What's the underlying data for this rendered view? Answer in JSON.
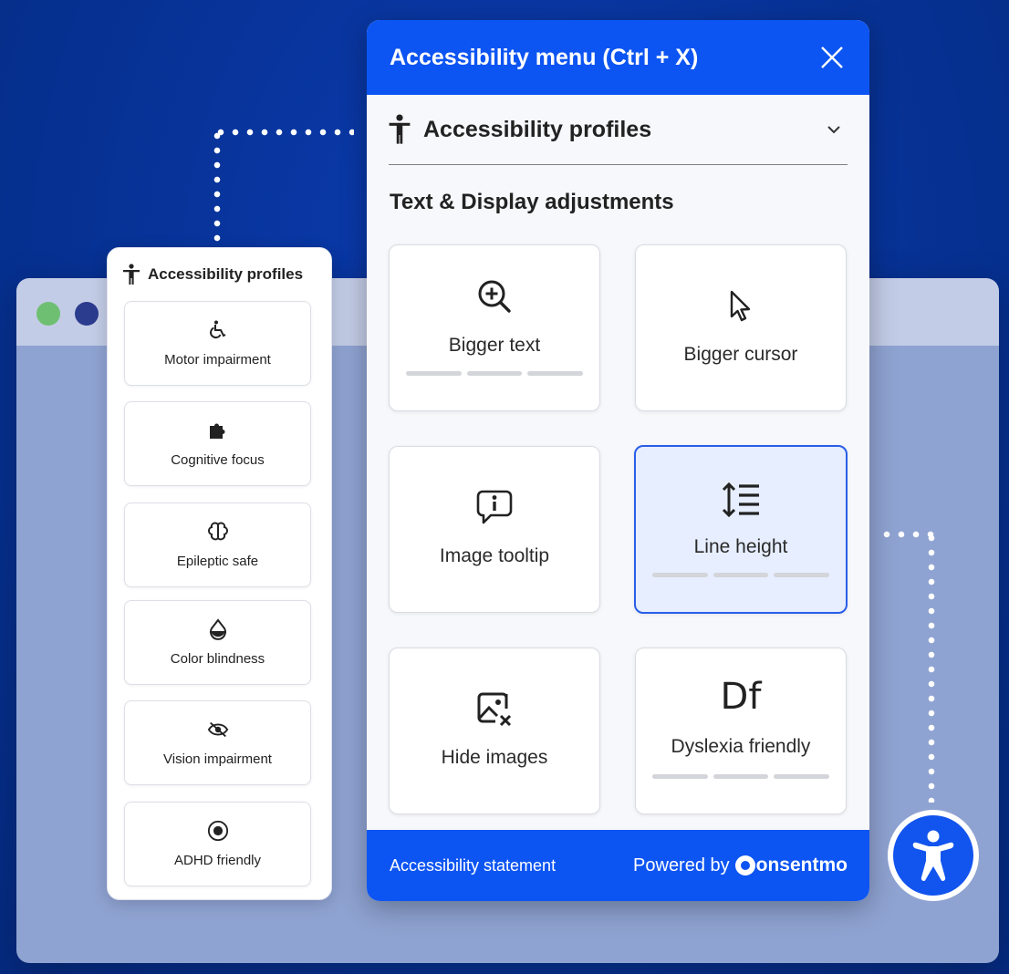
{
  "colors": {
    "background": "#0a36a0",
    "accent": "#0d55f2",
    "active_tile_bg": "#e6eeff",
    "active_tile_border": "#2a5ee8"
  },
  "menu": {
    "title": "Accessibility menu (Ctrl + X)",
    "profiles_label": "Accessibility profiles",
    "section_title": "Text & Display adjustments",
    "tiles": [
      {
        "label": "Bigger text",
        "icon": "zoom-in-icon",
        "levels": 3
      },
      {
        "label": "Bigger cursor",
        "icon": "cursor-icon"
      },
      {
        "label": "Image tooltip",
        "icon": "info-bubble-icon"
      },
      {
        "label": "Line height",
        "icon": "line-height-icon",
        "levels": 3,
        "active": true
      },
      {
        "label": "Hide images",
        "icon": "hide-image-icon"
      },
      {
        "label": "Dyslexia friendly",
        "icon": "dyslexia-font-icon",
        "icon_text": "Df",
        "levels": 3
      }
    ],
    "footer": {
      "statement": "Accessibility statement",
      "powered_by": "Powered by",
      "brand": "onsentmo"
    }
  },
  "profiles_card": {
    "title": "Accessibility profiles",
    "items": [
      {
        "label": "Motor impairment",
        "icon": "wheelchair-icon"
      },
      {
        "label": "Cognitive focus",
        "icon": "puzzle-icon"
      },
      {
        "label": "Epileptic safe",
        "icon": "brain-icon"
      },
      {
        "label": "Color blindness",
        "icon": "drop-icon"
      },
      {
        "label": "Vision impairment",
        "icon": "eye-off-icon"
      },
      {
        "label": "ADHD friendly",
        "icon": "target-icon"
      }
    ]
  }
}
